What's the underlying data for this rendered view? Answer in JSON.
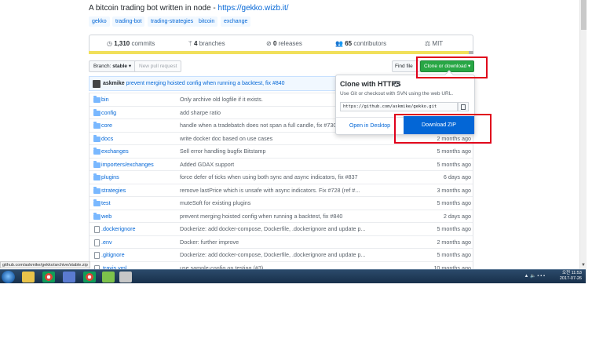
{
  "repo": {
    "description": "A bitcoin trading bot written in node - ",
    "url": "https://gekko.wizb.it/",
    "topics": [
      "gekko",
      "trading-bot",
      "trading-strategies",
      "bitcoin",
      "exchange"
    ]
  },
  "summary": {
    "commits_count": "1,310",
    "commits_label": " commits",
    "branches_count": "4",
    "branches_label": " branches",
    "releases_count": "0",
    "releases_label": " releases",
    "contributors_count": "65",
    "contributors_label": " contributors",
    "license": "MIT"
  },
  "toolbar": {
    "branch_label": "Branch: ",
    "branch_value": "stable",
    "new_pr": "New pull request",
    "find_file": "Find file",
    "clone_download": "Clone or download"
  },
  "latest_commit": {
    "author": "askmike",
    "message": "prevent merging hoisted config when running a backtest, fix ",
    "issue": "#840"
  },
  "files": [
    {
      "name": "bin",
      "type": "folder",
      "message": "Only archive old logfile if it exists.",
      "age": ""
    },
    {
      "name": "config",
      "type": "folder",
      "message": "add sharpe ratio",
      "age": ""
    },
    {
      "name": "core",
      "type": "folder",
      "message": "handle when a tradebatch does not span a full candle, fix #730",
      "age": ""
    },
    {
      "name": "docs",
      "type": "folder",
      "message": "write docker doc based on use cases",
      "age": "2 months ago"
    },
    {
      "name": "exchanges",
      "type": "folder",
      "message": "Sell error handling bugfix Bitstamp",
      "age": "5 months ago"
    },
    {
      "name": "importers/exchanges",
      "type": "folder",
      "message": "Added GDAX support",
      "age": "5 months ago"
    },
    {
      "name": "plugins",
      "type": "folder",
      "message": "force defer of ticks when using both sync and async indicators, fix #837",
      "age": "6 days ago"
    },
    {
      "name": "strategies",
      "type": "folder",
      "message": "remove lastPrice which is unsafe with async indicators. Fix #728 (ref #...",
      "age": "3 months ago"
    },
    {
      "name": "test",
      "type": "folder",
      "message": "muteSoft for existing plugins",
      "age": "5 months ago"
    },
    {
      "name": "web",
      "type": "folder",
      "message": "prevent merging hoisted config when running a backtest, fix #840",
      "age": "2 days ago"
    },
    {
      "name": ".dockerignore",
      "type": "file",
      "message": "Dockerize: add docker-compose, Dockerfile, .dockerignore and update p...",
      "age": "5 months ago"
    },
    {
      "name": ".env",
      "type": "file",
      "message": "Docker: further improve",
      "age": "2 months ago"
    },
    {
      "name": ".gitignore",
      "type": "file",
      "message": "Dockerize: add docker-compose, Dockerfile, .dockerignore and update p...",
      "age": "5 months ago"
    },
    {
      "name": ".travis.yml",
      "type": "file",
      "message": "use sample-config on testing (#3)",
      "age": "10 months ago"
    }
  ],
  "clone_popover": {
    "title": "Clone with HTTPS",
    "help": "?",
    "subtitle": "Use Git or checkout with SVN using the web URL.",
    "clone_url": "https://github.com/askmike/gekko.git",
    "open_desktop": "Open in Desktop",
    "download_zip": "Download ZIP"
  },
  "status_bar": {
    "url": "github.com/askmike/gekko/archive/stable.zip"
  },
  "taskbar": {
    "tray_icons": "▲ 🔈 ▪ ▪ ▪",
    "ime": "오전",
    "time": "11:53",
    "date": "2017-07-26"
  },
  "colors": {
    "accent_link": "#0366d6",
    "green_button": "#28a745",
    "annotation_red": "#e0001b",
    "language_bar": "#f1e05a"
  }
}
